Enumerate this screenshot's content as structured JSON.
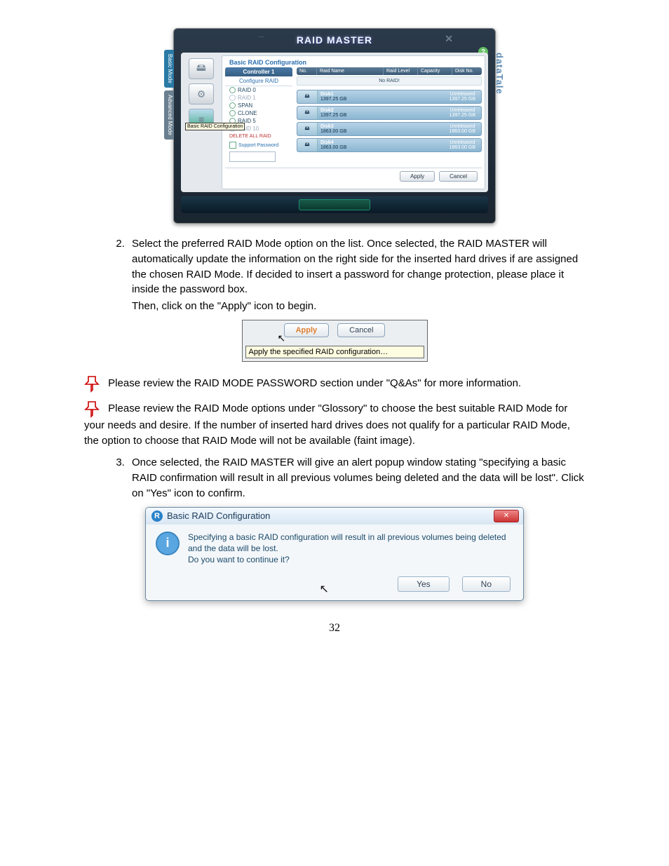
{
  "page_number": "32",
  "raid_master": {
    "title": "RAID MASTER",
    "panel_title": "Basic RAID Configuration",
    "side_brand": "dataTale",
    "side_tabs": {
      "basic": "Basic Mode",
      "advanced": "Advanced Mode"
    },
    "nav_tooltip": "Basic RAID Configuration",
    "controller": {
      "header": "Controller 1",
      "configure": "Configure RAID",
      "options": {
        "raid0": "RAID 0",
        "raid1": "RAID 1",
        "span": "SPAN",
        "clone": "CLONE",
        "raid5": "RAID 5",
        "raid10": "RAID 10"
      },
      "delete_all": "DELETE ALL RAID",
      "support_password": "Support Password"
    },
    "table_headers": {
      "no": "No.",
      "raid_name": "Raid Name",
      "raid_level": "Raid Level",
      "capacity": "Capacity",
      "disk_no": "Disk No."
    },
    "no_raid": "No RAID!",
    "disks": [
      {
        "name": "Disk1",
        "size": "1397.25 GB",
        "status": "Unreleased",
        "status_size": "1397.25 GB"
      },
      {
        "name": "Disk2",
        "size": "1397.25 GB",
        "status": "Unreleased",
        "status_size": "1397.25 GB"
      },
      {
        "name": "Disk3",
        "size": "1863.00 GB",
        "status": "Unreleased",
        "status_size": "1863.00 GB"
      },
      {
        "name": "Disk4",
        "size": "1863.00 GB",
        "status": "Unreleased",
        "status_size": "1863.00 GB"
      }
    ],
    "actions": {
      "apply": "Apply",
      "cancel": "Cancel"
    }
  },
  "steps": {
    "two": "Select the preferred RAID Mode option on the list.  Once selected, the RAID MASTER will automatically update the information on the right side for the inserted hard drives if are assigned the chosen RAID Mode.  If decided to insert a password for change protection, please place it inside the password box.",
    "two_follow": "Then, click on the \"Apply\" icon to begin.",
    "three": "Once selected, the RAID MASTER will give an alert popup window stating \"specifying a basic RAID confirmation will result in all previous volumes being deleted and the data will be lost\".  Click on \"Yes\" icon to confirm."
  },
  "snippet": {
    "apply": "Apply",
    "cancel": "Cancel",
    "tooltip": "Apply the specified RAID configuration…"
  },
  "notes": {
    "n1": "Please review the RAID MODE PASSWORD section under \"Q&As\" for more information.",
    "n2": "Please review the RAID Mode options under \"Glossory\" to choose the best suitable RAID Mode for your needs and desire.  If the number of inserted hard drives does not qualify for a particular RAID Mode, the option to choose that RAID Mode will not be available (faint image)."
  },
  "dialog": {
    "title": "Basic RAID Configuration",
    "body_line1": "Specifying a basic RAID configuration will result in all previous volumes being deleted and the data will be lost.",
    "body_line2": "Do you want to continue it?",
    "yes": "Yes",
    "no": "No"
  }
}
